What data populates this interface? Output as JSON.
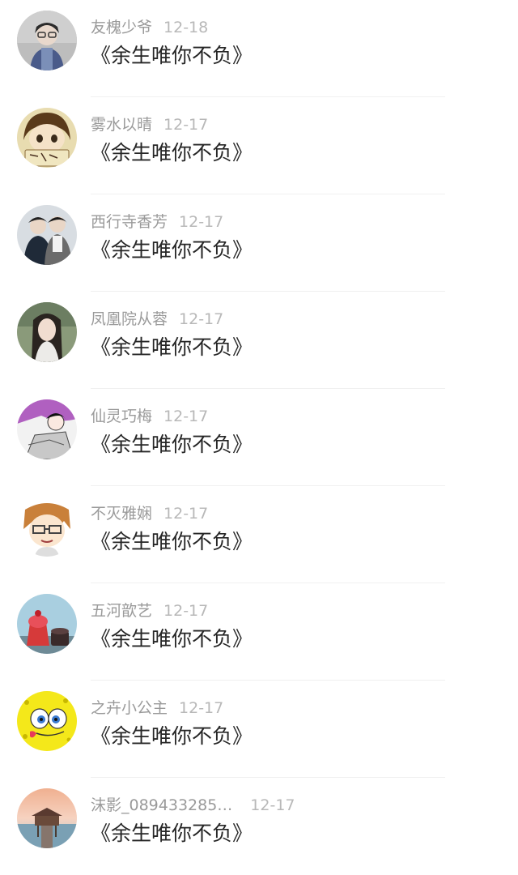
{
  "comments": [
    {
      "user": "友槐少爷",
      "date": "12-18",
      "text": "《余生唯你不负》",
      "avatar": "boy-photo-avatar"
    },
    {
      "user": "雾水以晴",
      "date": "12-17",
      "text": "《余生唯你不负》",
      "avatar": "cartoon-kid-avatar"
    },
    {
      "user": "西行寺香芳",
      "date": "12-17",
      "text": "《余生唯你不负》",
      "avatar": "couple-photo-avatar"
    },
    {
      "user": "凤凰院从蓉",
      "date": "12-17",
      "text": "《余生唯你不负》",
      "avatar": "girl-photo-avatar"
    },
    {
      "user": "仙灵巧梅",
      "date": "12-17",
      "text": "《余生唯你不负》",
      "avatar": "illustration-avatar"
    },
    {
      "user": "不灭雅娴",
      "date": "12-17",
      "text": "《余生唯你不负》",
      "avatar": "anime-glasses-avatar"
    },
    {
      "user": "五河歆艺",
      "date": "12-17",
      "text": "《余生唯你不负》",
      "avatar": "dessert-avatar"
    },
    {
      "user": "之卉小公主",
      "date": "12-17",
      "text": "《余生唯你不负》",
      "avatar": "spongebob-avatar"
    },
    {
      "user": "沫影_089433285…",
      "date": "12-17",
      "text": "《余生唯你不负》",
      "avatar": "pier-sunset-avatar"
    }
  ]
}
